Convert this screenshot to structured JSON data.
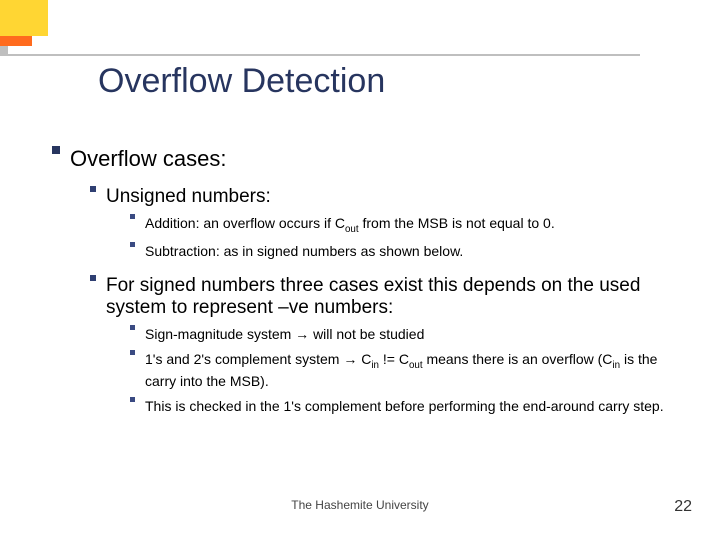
{
  "title": "Overflow Detection",
  "lvl1": "Overflow cases:",
  "unsigned": {
    "heading": "Unsigned numbers:",
    "addition_a": "Addition: an overflow occurs if C",
    "addition_sub": "out",
    "addition_b": " from the MSB is not equal to 0.",
    "subtraction": "Subtraction: as in signed numbers as shown below."
  },
  "signed": {
    "heading": "For signed numbers three cases exist this depends on the used system to represent –ve numbers:",
    "signmag": "Sign-magnitude system → will not be studied",
    "comp_a": "1's and 2's complement system → C",
    "comp_sub1": "in",
    "comp_b": " != C",
    "comp_sub2": "out",
    "comp_c": " means there is an overflow (C",
    "comp_sub3": "in",
    "comp_d": " is the carry into the MSB).",
    "check": "This is checked in the 1's complement before performing the end-around carry step."
  },
  "footer_center": "The Hashemite University",
  "page_number": "22"
}
